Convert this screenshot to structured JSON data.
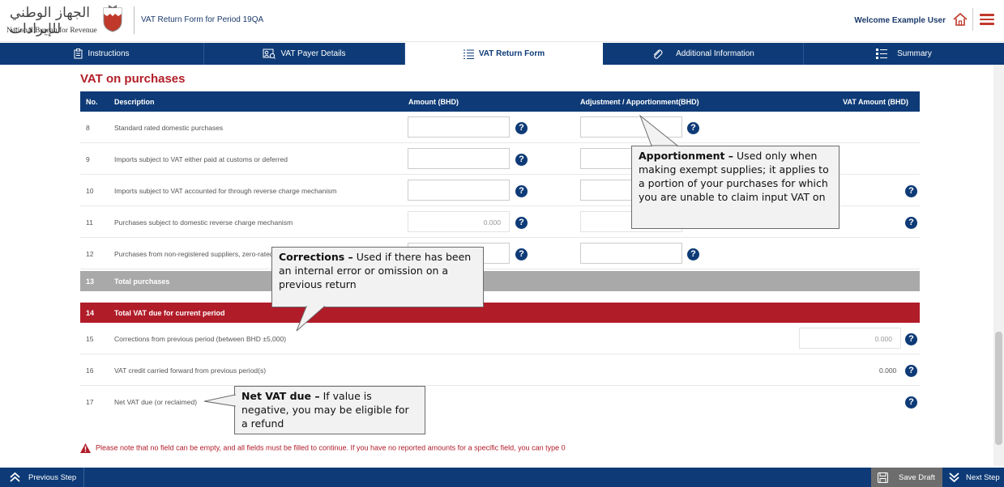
{
  "header": {
    "logo_arabic": "الجهاز الوطني للإيرادات",
    "logo_english": "National Bureau for Revenue",
    "form_title": "VAT Return Form for Period 19QA",
    "welcome": "Welcome Example User",
    "home_icon": "home-icon",
    "menu_icon": "hamburger-menu-icon"
  },
  "steps": [
    {
      "label": "Instructions",
      "icon": "clipboard-icon",
      "active": false
    },
    {
      "label": "VAT Payer Details",
      "icon": "id-card-icon",
      "active": false
    },
    {
      "label": "VAT Return Form",
      "icon": "list-icon",
      "active": true
    },
    {
      "label": "Additional Information",
      "icon": "paperclip-icon",
      "active": false
    },
    {
      "label": "Summary",
      "icon": "checklist-icon",
      "active": false
    }
  ],
  "section": {
    "title": "VAT on purchases",
    "columns": {
      "no": "No.",
      "description": "Description",
      "amount": "Amount (BHD)",
      "adjustment": "Adjustment / Apportionment(BHD)",
      "vat_amount": "VAT Amount (BHD)"
    }
  },
  "rows": [
    {
      "no": "8",
      "description": "Standard rated domestic purchases"
    },
    {
      "no": "9",
      "description": "Imports subject to VAT either paid at customs or deferred"
    },
    {
      "no": "10",
      "description": "Imports subject to VAT accounted for through reverse charge mechanism"
    },
    {
      "no": "11",
      "description": "Purchases subject to domestic reverse charge mechanism",
      "amount": "0.000"
    },
    {
      "no": "12",
      "description": "Purchases from non-registered suppliers, zero-rated"
    },
    {
      "no": "13",
      "description": "Total purchases"
    },
    {
      "no": "14",
      "description": "Total VAT due for current period"
    },
    {
      "no": "15",
      "description": "Corrections from previous period (between BHD ±5,000)",
      "vat_amount": "0.000"
    },
    {
      "no": "16",
      "description": "VAT credit carried forward from previous period(s)",
      "vat_amount": "0.000"
    },
    {
      "no": "17",
      "description": "Net VAT due (or reclaimed)"
    }
  ],
  "callouts": {
    "apportionment": {
      "title": "Apportionment –",
      "text": " Used only when making exempt supplies; it applies to a portion of your purchases for which you are unable to claim input VAT on"
    },
    "corrections": {
      "title": "Corrections –",
      "text": " Used if there has been an internal error or omission on a previous return"
    },
    "net_vat": {
      "title": "Net VAT due –",
      "text": " If value is negative, you may be eligible for a refund"
    }
  },
  "warning": "Please note that no field can be empty, and all fields must be filled to continue. If you have no reported amounts for a specific field, you can type 0",
  "footer": {
    "previous": "Previous Step",
    "save": "Save Draft",
    "next": "Next Step"
  },
  "help_glyph": "?",
  "colors": {
    "navy": "#0e3b77",
    "red": "#b11c29",
    "gray_band": "#a9a9a9",
    "title_red": "#b21e28"
  }
}
